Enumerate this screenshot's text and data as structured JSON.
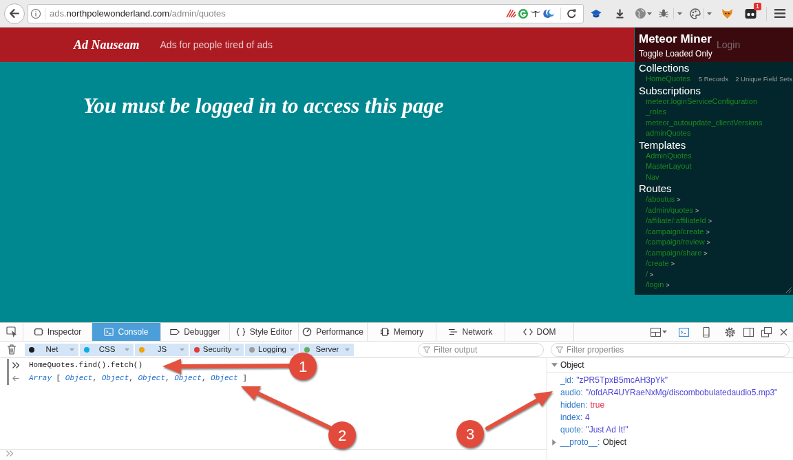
{
  "browser": {
    "url": {
      "subdomain": "ads.",
      "domain": "northpolewonderland.com",
      "path": "/admin/quotes"
    },
    "extension_badge": "1"
  },
  "site": {
    "brand": "Ad Nauseam",
    "tagline": "Ads for people tired of ads",
    "nav_link": "Login",
    "message": "You must be logged in to access this page"
  },
  "meteor_miner": {
    "title": "Meteor Miner",
    "toggle": "Toggle Loaded Only",
    "sections": [
      {
        "kind": "collections",
        "heading": "Collections",
        "items": [
          {
            "name": "HomeQuotes",
            "records": "5 Records",
            "field_sets": "2 Unique Field Sets"
          }
        ]
      },
      {
        "kind": "subscriptions",
        "heading": "Subscriptions",
        "items": [
          {
            "name": "meteor.loginServiceConfiguration"
          },
          {
            "name": "_roles"
          },
          {
            "name": "meteor_autoupdate_clientVersions"
          },
          {
            "name": "adminQuotes"
          }
        ]
      },
      {
        "kind": "templates",
        "heading": "Templates",
        "items": [
          {
            "name": "AdminQuotes"
          },
          {
            "name": "MasterLayout"
          },
          {
            "name": "Nav"
          }
        ]
      },
      {
        "kind": "routes",
        "heading": "Routes",
        "items": [
          {
            "name": "/aboutus",
            "caret": ">"
          },
          {
            "name": "/admin/quotes",
            "caret": ">"
          },
          {
            "name": "/affiliate/:affiliateId",
            "caret": ">"
          },
          {
            "name": "/campaign/create",
            "caret": ">"
          },
          {
            "name": "/campaign/review",
            "caret": ">"
          },
          {
            "name": "/campaign/share",
            "caret": ">"
          },
          {
            "name": "/create",
            "caret": ">"
          },
          {
            "name": "/",
            "caret": ">"
          },
          {
            "name": "/login",
            "caret": ">"
          }
        ]
      }
    ]
  },
  "devtools": {
    "tabs": [
      {
        "label": "Inspector",
        "selected": false
      },
      {
        "label": "Console",
        "selected": true
      },
      {
        "label": "Debugger",
        "selected": false
      },
      {
        "label": "Style Editor",
        "selected": false
      },
      {
        "label": "Performance",
        "selected": false
      },
      {
        "label": "Memory",
        "selected": false
      },
      {
        "label": "Network",
        "selected": false
      },
      {
        "label": "DOM",
        "selected": false
      }
    ],
    "filters": [
      {
        "label": "Net",
        "color": "#1c1c1c",
        "on": true
      },
      {
        "label": "CSS",
        "color": "#0aaee6",
        "on": true
      },
      {
        "label": "JS",
        "color": "#f0a30a",
        "on": true
      },
      {
        "label": "Security",
        "color": "#e63a3a",
        "on": true
      },
      {
        "label": "Logging",
        "color": "#9c9c9c",
        "on": true
      },
      {
        "label": "Server",
        "color": "#5eae5e",
        "on": true
      }
    ],
    "filter_output": {
      "placeholder": "Filter output"
    },
    "filter_properties": {
      "placeholder": "Filter properties"
    },
    "console": [
      {
        "kind": "input",
        "text": "HomeQuotes.find().fetch()"
      },
      {
        "kind": "output",
        "text": "*Array* [ *Object*, *Object*, *Object*, *Object*, *Object* ]"
      }
    ],
    "inspector": {
      "label": "Object",
      "expanded": true,
      "properties": [
        {
          "kind": "string",
          "key": "_id:",
          "value": "\"zPR5TpxB5mcAH3pYk\""
        },
        {
          "kind": "string",
          "key": "audio:",
          "value": "\"/ofdAR4UYRaeNxMg/discombobulatedaudio5.mp3\""
        },
        {
          "kind": "boolean",
          "key": "hidden:",
          "value": "true"
        },
        {
          "kind": "number",
          "key": "index:",
          "value": "4"
        },
        {
          "kind": "string",
          "key": "quote:",
          "value": "\"Just Ad It!\""
        },
        {
          "kind": "object",
          "key": "__proto__:",
          "value": "Object",
          "expanded": false
        }
      ]
    }
  },
  "annotations": [
    {
      "label": "1"
    },
    {
      "label": "2"
    },
    {
      "label": "3"
    }
  ]
}
